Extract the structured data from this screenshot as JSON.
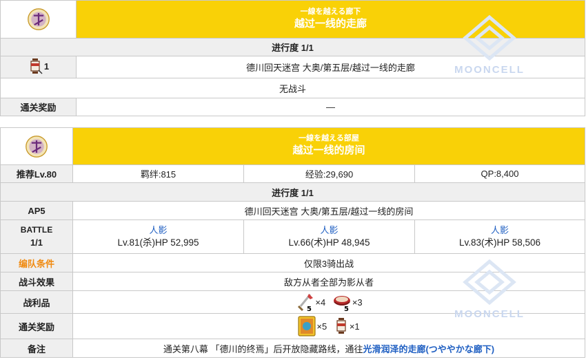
{
  "quest1": {
    "title_jp": "一線を越える廊下",
    "title_cn": "越过一线的走廊",
    "progress": "进行度 1/1",
    "ap_value": "1",
    "location": "德川回天迷宫 大奥/第五层/越过一线的走廊",
    "battle_text": "无战斗",
    "reward_label": "通关奖励",
    "reward_value": "—"
  },
  "quest2": {
    "title_jp": "一線を越える部屋",
    "title_cn": "越过一线的房间",
    "rec_level": "推荐Lv.80",
    "bond": "羁绊:815",
    "exp": "经验:29,690",
    "qp": "QP:8,400",
    "progress": "进行度 1/1",
    "ap": "AP5",
    "location": "德川回天迷宫 大奥/第五层/越过一线的房间",
    "battle_label": "BATTLE",
    "battle_count": "1/1",
    "enemies": [
      {
        "name": "人影",
        "stats": "Lv.81(杀)HP 52,995"
      },
      {
        "name": "人影",
        "stats": "Lv.66(术)HP 48,945"
      },
      {
        "name": "人影",
        "stats": "Lv.83(术)HP 58,506"
      }
    ],
    "formation_label": "编队条件",
    "formation_value": "仅限3骑出战",
    "effect_label": "战斗效果",
    "effect_value": "敌方从者全部为影从者",
    "drops_label": "战利品",
    "drops": [
      {
        "icon": "key-item-icon",
        "badge": "5",
        "count": "×4"
      },
      {
        "icon": "bowl-item-icon",
        "badge": "5",
        "count": "×3"
      }
    ],
    "rewards_label": "通关奖励",
    "rewards": [
      {
        "icon": "craft-essence-icon",
        "count": "×5"
      },
      {
        "icon": "lantern-icon",
        "count": "×1"
      }
    ],
    "note_label": "备注",
    "note_prefix": "通关第八幕 「德川的终焉」后开放隐藏路线，通往",
    "note_link": "光滑润泽的走廊(つややかな廊下)"
  },
  "watermark": "MOONCELL",
  "colors": {
    "title_bg": "#f9d107",
    "label_bg": "#efefef",
    "link": "#1f5fc2",
    "orange": "#f08a10"
  }
}
